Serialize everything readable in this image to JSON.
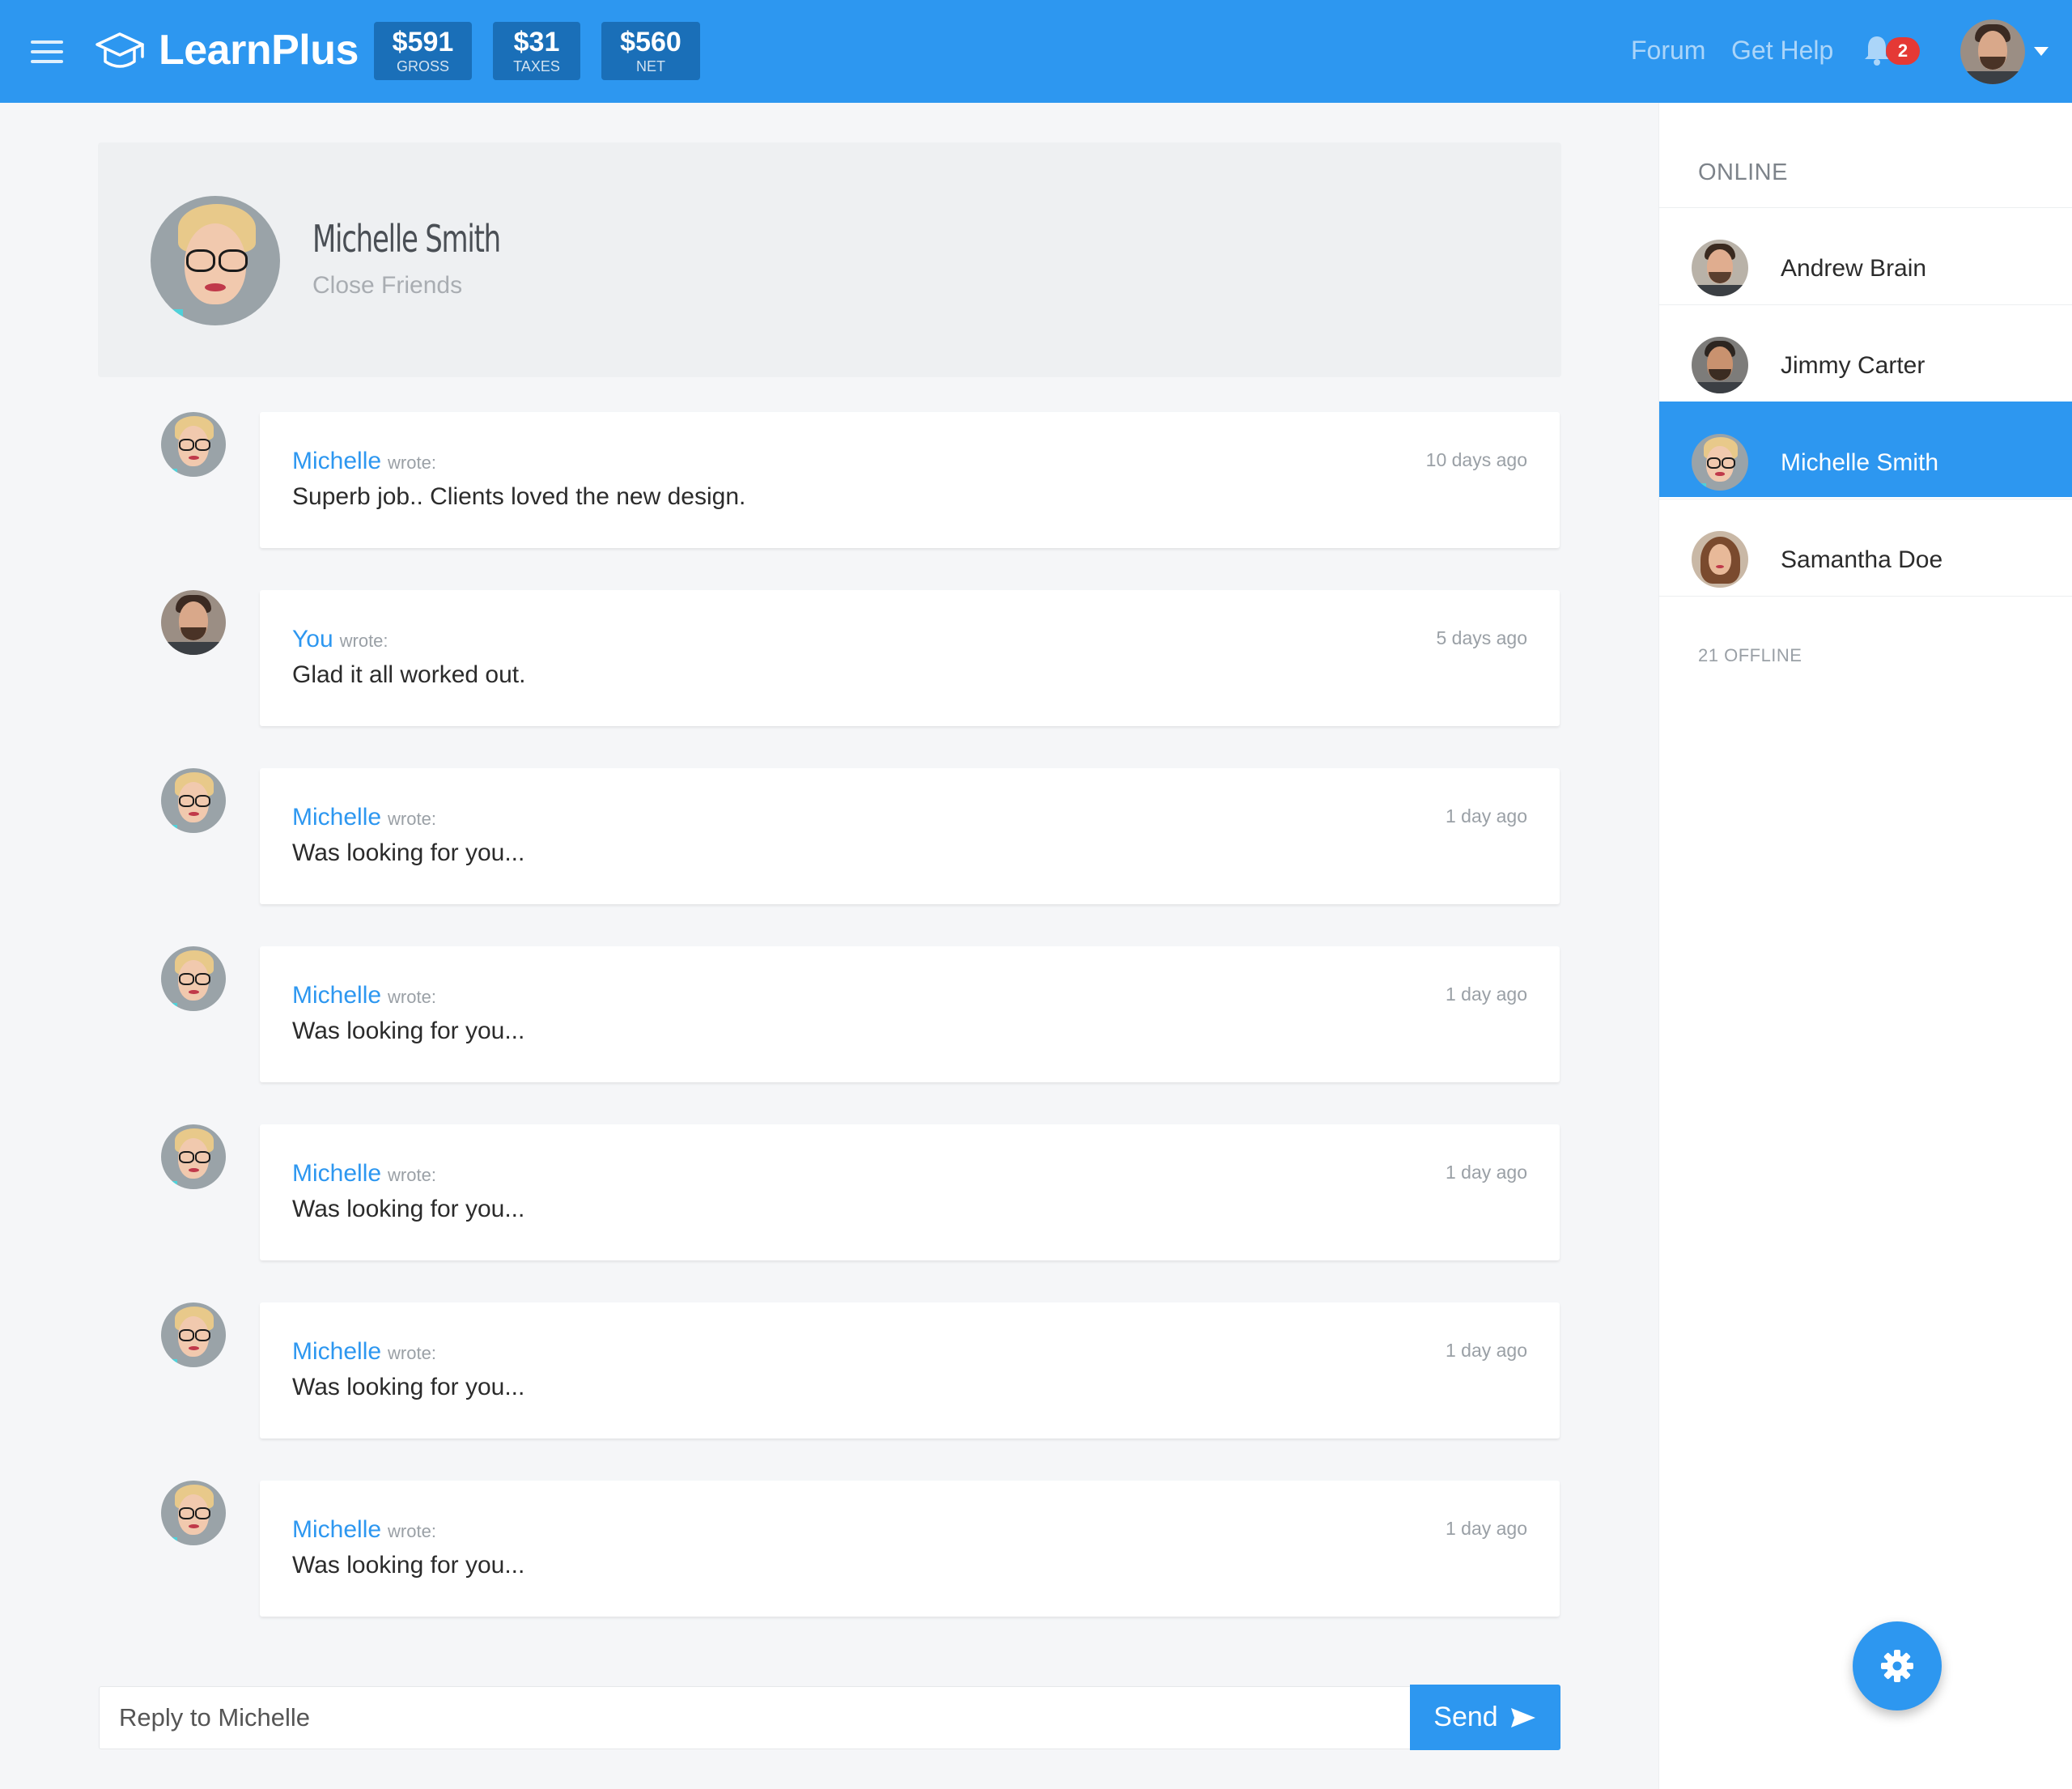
{
  "header": {
    "brand": "LearnPlus",
    "stats": [
      {
        "value": "$591",
        "label": "GROSS"
      },
      {
        "value": "$31",
        "label": "TAXES"
      },
      {
        "value": "$560",
        "label": "NET"
      }
    ],
    "links": [
      "Forum",
      "Get Help"
    ],
    "notification_count": "2",
    "colors": {
      "bar": "#2d97f0",
      "stat_bg": "#1a6fb8",
      "badge": "#e53935"
    }
  },
  "profile": {
    "name": "Michelle Smith",
    "group": "Close Friends"
  },
  "messages": [
    {
      "author": "Michelle",
      "wrote": "wrote:",
      "time": "10 days ago",
      "text": "Superb job.. Clients loved the new design.",
      "avatar": "michelle-avatar"
    },
    {
      "author": "You",
      "wrote": "wrote:",
      "time": "5 days ago",
      "text": "Glad it all worked out.",
      "avatar": "user-avatar"
    },
    {
      "author": "Michelle",
      "wrote": "wrote:",
      "time": "1 day ago",
      "text": "Was looking for you...",
      "avatar": "michelle-avatar"
    },
    {
      "author": "Michelle",
      "wrote": "wrote:",
      "time": "1 day ago",
      "text": "Was looking for you...",
      "avatar": "michelle-avatar"
    },
    {
      "author": "Michelle",
      "wrote": "wrote:",
      "time": "1 day ago",
      "text": "Was looking for you...",
      "avatar": "michelle-avatar"
    },
    {
      "author": "Michelle",
      "wrote": "wrote:",
      "time": "1 day ago",
      "text": "Was looking for you...",
      "avatar": "michelle-avatar"
    },
    {
      "author": "Michelle",
      "wrote": "wrote:",
      "time": "1 day ago",
      "text": "Was looking for you...",
      "avatar": "michelle-avatar"
    }
  ],
  "reply": {
    "placeholder": "Reply to Michelle",
    "send_label": "Send"
  },
  "sidebar": {
    "online_heading": "ONLINE",
    "contacts": [
      {
        "name": "Andrew Brain",
        "active": false
      },
      {
        "name": "Jimmy Carter",
        "active": false
      },
      {
        "name": "Michelle Smith",
        "active": true
      },
      {
        "name": "Samantha Doe",
        "active": false
      }
    ],
    "offline_label": "21 OFFLINE"
  },
  "icons": {
    "menu": "hamburger-menu-icon",
    "brand": "graduation-cap-icon",
    "bell": "bell-icon",
    "send": "send-arrow-icon",
    "settings": "gear-icon"
  }
}
